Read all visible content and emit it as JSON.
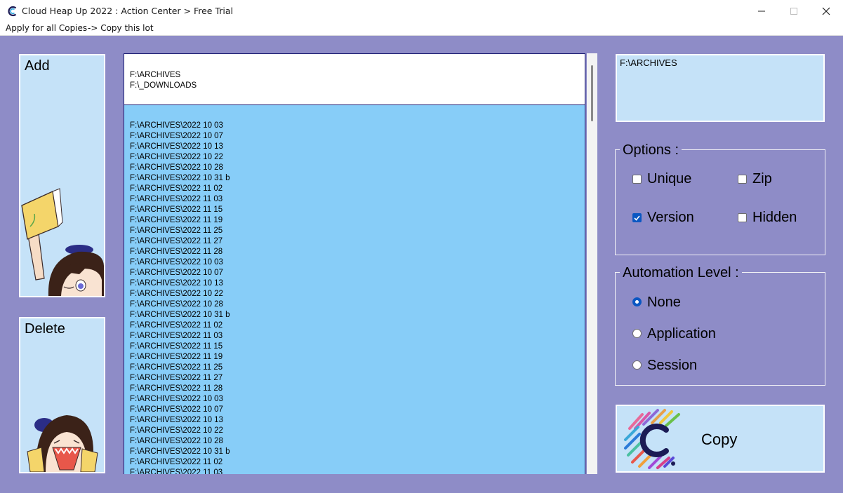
{
  "window": {
    "title": "Cloud Heap Up 2022 : Action Center > Free Trial",
    "minimize_icon": "minimize-icon",
    "maximize_icon": "maximize-icon",
    "close_icon": "close-icon"
  },
  "menu": {
    "apply_all": "Apply for all Copies",
    "copy_lot": "-> Copy this lot"
  },
  "left": {
    "add_label": "Add",
    "delete_label": "Delete"
  },
  "sources": [
    "F:\\ARCHIVES",
    "F:\\_DOWNLOADS"
  ],
  "folders": [
    "F:\\ARCHIVES\\2022 10 03",
    "F:\\ARCHIVES\\2022 10 07",
    "F:\\ARCHIVES\\2022 10 13",
    "F:\\ARCHIVES\\2022 10 22",
    "F:\\ARCHIVES\\2022 10 28",
    "F:\\ARCHIVES\\2022 10 31 b",
    "F:\\ARCHIVES\\2022 11 02",
    "F:\\ARCHIVES\\2022 11 03",
    "F:\\ARCHIVES\\2022 11 15",
    "F:\\ARCHIVES\\2022 11 19",
    "F:\\ARCHIVES\\2022 11 25",
    "F:\\ARCHIVES\\2022 11 27",
    "F:\\ARCHIVES\\2022 11 28",
    "F:\\ARCHIVES\\2022 10 03",
    "F:\\ARCHIVES\\2022 10 07",
    "F:\\ARCHIVES\\2022 10 13",
    "F:\\ARCHIVES\\2022 10 22",
    "F:\\ARCHIVES\\2022 10 28",
    "F:\\ARCHIVES\\2022 10 31 b",
    "F:\\ARCHIVES\\2022 11 02",
    "F:\\ARCHIVES\\2022 11 03",
    "F:\\ARCHIVES\\2022 11 15",
    "F:\\ARCHIVES\\2022 11 19",
    "F:\\ARCHIVES\\2022 11 25",
    "F:\\ARCHIVES\\2022 11 27",
    "F:\\ARCHIVES\\2022 11 28",
    "F:\\ARCHIVES\\2022 10 03",
    "F:\\ARCHIVES\\2022 10 07",
    "F:\\ARCHIVES\\2022 10 13",
    "F:\\ARCHIVES\\2022 10 22",
    "F:\\ARCHIVES\\2022 10 28",
    "F:\\ARCHIVES\\2022 10 31 b",
    "F:\\ARCHIVES\\2022 11 02",
    "F:\\ARCHIVES\\2022 11 03"
  ],
  "destination": "F:\\ARCHIVES",
  "options": {
    "title": "Options :",
    "unique": "Unique",
    "zip": "Zip",
    "version": "Version",
    "hidden": "Hidden",
    "unique_checked": false,
    "zip_checked": false,
    "version_checked": true,
    "hidden_checked": false
  },
  "automation": {
    "title": "Automation Level :",
    "none": "None",
    "application": "Application",
    "session": "Session",
    "selected": "None"
  },
  "copy_button": {
    "label": "Copy",
    "logo": "cloud-heap-up-logo"
  },
  "colors": {
    "background": "#8e8cc7",
    "panel": "#c5e2f8",
    "list": "#87cdf8",
    "accent": "#0b57c2",
    "list_border": "#1d1e74"
  }
}
